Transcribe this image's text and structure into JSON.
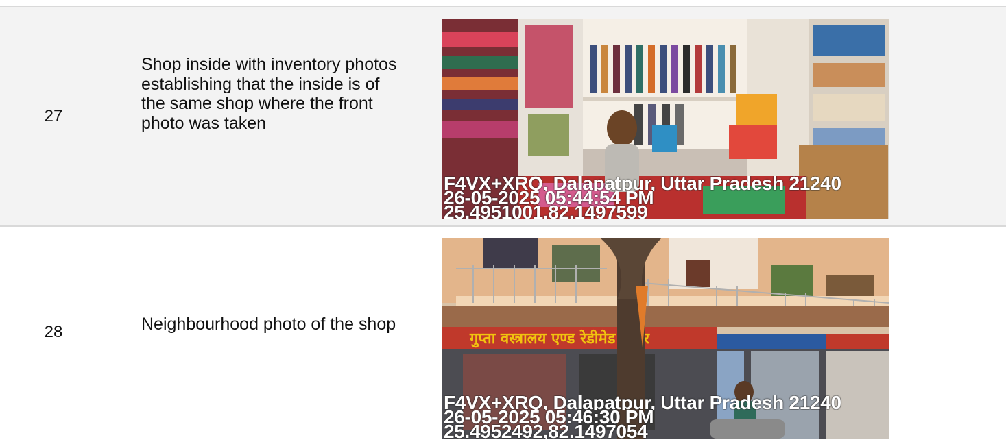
{
  "rows": [
    {
      "number": "27",
      "description": "Shop inside with inventory photos establishing that the inside is of the same shop where the front photo was taken",
      "photo": {
        "subject": "shop-interior",
        "stamp_lines": [
          "F4VX+XRQ, Dalapatpur, Uttar Pradesh 21240",
          "26-05-2025 05:44:54 PM",
          "25.4951001,82.1497599"
        ]
      }
    },
    {
      "number": "28",
      "description": "Neighbourhood photo of the shop",
      "photo": {
        "subject": "shop-exterior",
        "stamp_lines": [
          "F4VX+XRQ, Dalapatpur, Uttar Pradesh 21240",
          "26-05-2025 05:46:30 PM",
          "25.4952492,82.1497054"
        ]
      }
    }
  ],
  "colors": {
    "row_alt": "#f3f3f3",
    "border": "#d9d9d9",
    "signboard": "#c0392b",
    "signboard_text": "#f1c40f"
  }
}
